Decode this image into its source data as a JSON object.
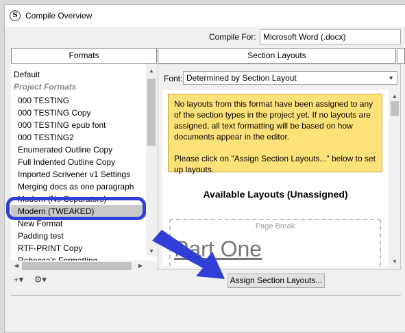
{
  "window": {
    "title": "Compile Overview"
  },
  "compile_for": {
    "label": "Compile For:",
    "value": "Microsoft Word (.docx)"
  },
  "formats": {
    "header": "Formats",
    "default_item": "Default",
    "group_label": "Project Formats",
    "items": [
      "000 TESTING",
      "000 TESTING Copy",
      "000 TESTING epub font",
      "000 TESTING2",
      "Enumerated Outline Copy",
      "Full Indented Outline Copy",
      "Imported Scrivener v1 Settings",
      "Merging docs as one paragraph",
      "Modern (No Separators)",
      "Modern (TWEAKED)",
      "New Format",
      "Padding test",
      "RTF-PRINT Copy",
      "Rebecca's Formatting"
    ],
    "selected_index": 9
  },
  "section_layouts": {
    "header": "Section Layouts",
    "font_label": "Font:",
    "font_value": "Determined by Section Layout",
    "note_p1": "No layouts from this format have been assigned to any of the section types in the project yet. If no layouts are assigned, all text formatting will be based on how documents appear in the editor.",
    "note_p2": "Please click on \"Assign Section Layouts...\" below to set up layouts.",
    "available_title": "Available Layouts (Unassigned)",
    "page_break_label": "Page Break",
    "preview_text": "Part One",
    "assign_button": "Assign Section Layouts..."
  },
  "icons": [
    "add-icon",
    "gear-icon"
  ],
  "colors": {
    "highlight": "#2f3fd6",
    "note_bg": "#fde27a"
  }
}
